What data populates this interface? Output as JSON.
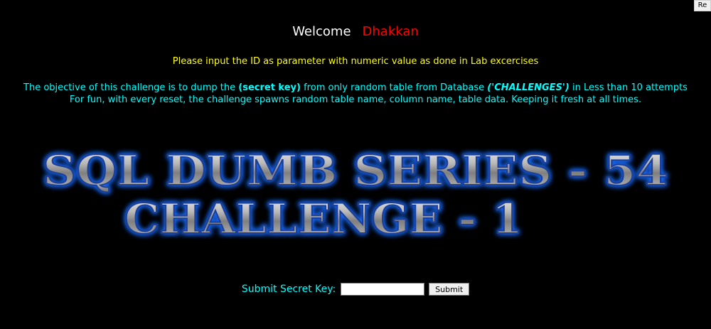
{
  "reset_label": "Re",
  "welcome": {
    "text": "Welcome",
    "name": "Dhakkan"
  },
  "instruction": "Please input the ID as parameter with numeric value as done in Lab excercises",
  "objective": {
    "part1": "The objective of this challenge is to dump the ",
    "secret": "(secret key)",
    "part2": " from only random table from Database ",
    "database": "('CHALLENGES')",
    "part3": " in Less than 10 attempts",
    "line2": "For fun, with every reset, the challenge spawns random table name, column name, table data. Keeping it fresh at all times."
  },
  "banner": {
    "line1": "SQL DUMB SERIES - 54",
    "line2": "CHALLENGE - 1"
  },
  "form": {
    "label": "Submit Secret Key:",
    "input_value": "",
    "button": "Submit"
  },
  "colors": {
    "background": "#000000",
    "welcome_name": "#ff0000",
    "instruction": "#ffff00",
    "objective": "#00ffff",
    "banner_glow": "#1e6cff"
  }
}
